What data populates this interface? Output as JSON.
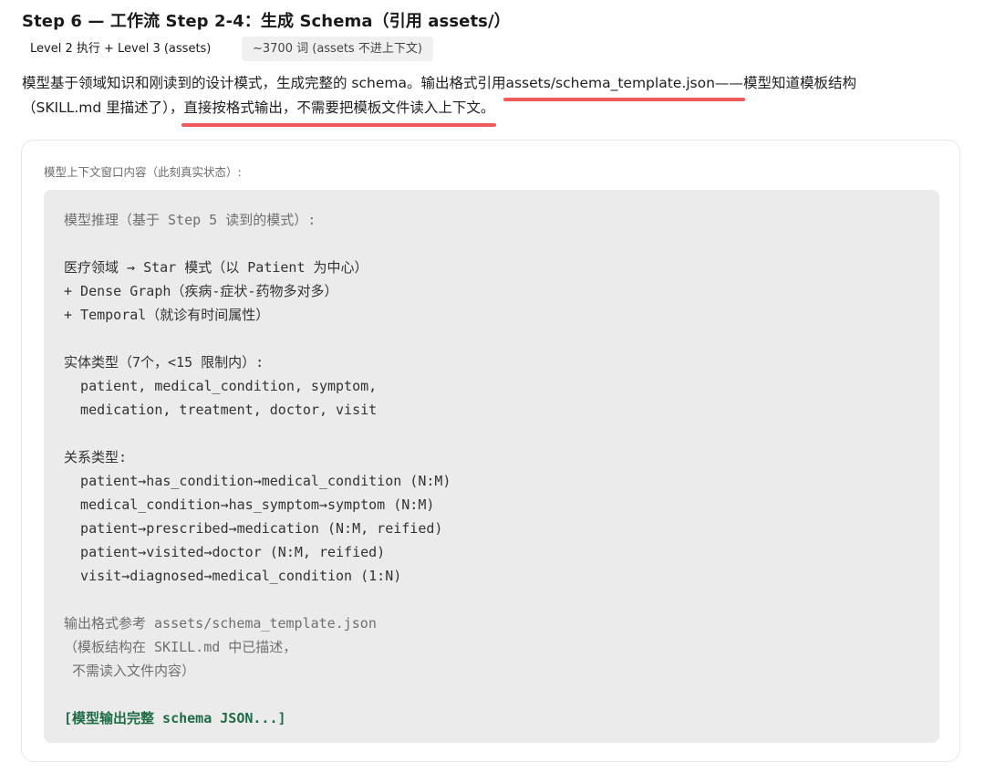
{
  "header": {
    "title": "Step 6 — 工作流 Step 2-4：生成 Schema（引用 assets/）",
    "tag_level": "Level 2 执行 + Level 3 (assets)",
    "tag_words": "~3700 词 (assets 不进上下文)"
  },
  "description": {
    "line1_prefix": "模型基于领域知识和刚读到的设计模式，生成完整的 schema。输出格式引用",
    "line1_highlight": " assets/schema_template.json——",
    "line1_suffix": "模型知道模板结构",
    "line2_prefix": "（SKILL.md 里描述了），",
    "line2_highlight": "直接按格式输出，不需要把模板文件读入上下文。"
  },
  "panel": {
    "label": "模型上下文窗口内容（此刻真实状态）:",
    "lines": [
      {
        "text": "模型推理（基于 Step 5 读到的模式）:",
        "kind": "comment"
      },
      {
        "text": "",
        "kind": "blank"
      },
      {
        "text": "医疗领域 → Star 模式（以 Patient 为中心）",
        "kind": "normal"
      },
      {
        "text": "+ Dense Graph（疾病-症状-药物多对多）",
        "kind": "normal"
      },
      {
        "text": "+ Temporal（就诊有时间属性）",
        "kind": "normal"
      },
      {
        "text": "",
        "kind": "blank"
      },
      {
        "text": "实体类型（7个，<15 限制内）:",
        "kind": "normal"
      },
      {
        "text": "  patient, medical_condition, symptom,",
        "kind": "normal"
      },
      {
        "text": "  medication, treatment, doctor, visit",
        "kind": "normal"
      },
      {
        "text": "",
        "kind": "blank"
      },
      {
        "text": "关系类型:",
        "kind": "normal"
      },
      {
        "text": "  patient→has_condition→medical_condition (N:M)",
        "kind": "normal"
      },
      {
        "text": "  medical_condition→has_symptom→symptom (N:M)",
        "kind": "normal"
      },
      {
        "text": "  patient→prescribed→medication (N:M, reified)",
        "kind": "normal"
      },
      {
        "text": "  patient→visited→doctor (N:M, reified)",
        "kind": "normal"
      },
      {
        "text": "  visit→diagnosed→medical_condition (1:N)",
        "kind": "normal"
      },
      {
        "text": "",
        "kind": "blank"
      },
      {
        "text": "输出格式参考 assets/schema_template.json",
        "kind": "comment"
      },
      {
        "text": "（模板结构在 SKILL.md 中已描述，",
        "kind": "comment"
      },
      {
        "text": " 不需读入文件内容）",
        "kind": "comment"
      },
      {
        "text": "",
        "kind": "blank"
      },
      {
        "text": "[模型输出完整 schema JSON...]",
        "kind": "output"
      }
    ]
  },
  "colors": {
    "highlight_underline": "#f05a5a",
    "output_text": "#1f6b45",
    "code_bg": "#ebebeb"
  }
}
